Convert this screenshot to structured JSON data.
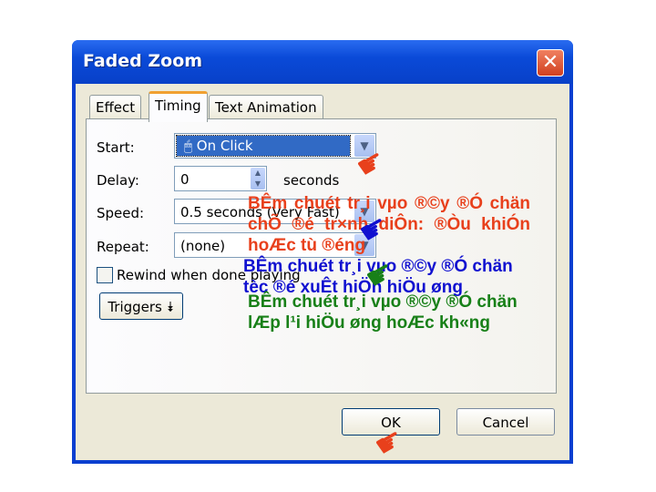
{
  "dialog": {
    "title": "Faded Zoom",
    "close_label": "✕",
    "tabs": [
      {
        "label": "Effect"
      },
      {
        "label": "Timing"
      },
      {
        "label": "Text Animation"
      }
    ],
    "start": {
      "label": "Start:",
      "value": "On Click"
    },
    "delay": {
      "label": "Delay:",
      "value": "0",
      "unit": "seconds"
    },
    "speed": {
      "label": "Speed:",
      "value": "0.5 seconds (Very Fast)"
    },
    "repeat": {
      "label": "Repeat:",
      "value": "(none)"
    },
    "rewind": {
      "label": "Rewind when done playing",
      "checked": false
    },
    "triggers_label": "Triggers",
    "ok_label": "OK",
    "cancel_label": "Cancel"
  },
  "annotations": [
    {
      "text": "BÊm chuét tr¸i vµo ®©y ®Ó chän chÕ ®é tr×nh diÔn: ®Òu khiÓn hoÆc tù ®éng",
      "color": "#e8401c"
    },
    {
      "text": "BÊm chuét tr¸i vµo ®©y ®Ó chän tèc ®é xuÊt hiÖn hiÖu øng",
      "color": "#1010d0"
    },
    {
      "text": "BÊm chuét tr¸i vµo ®©y ®Ó chän lÆp l¹i hiÖu øng hoÆc kh«ng",
      "color": "#188018"
    }
  ]
}
